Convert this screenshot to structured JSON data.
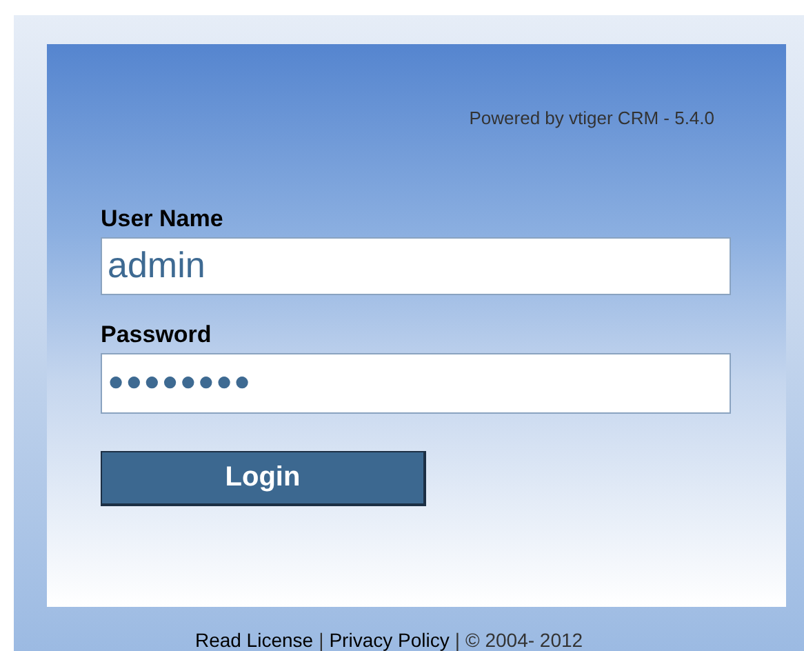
{
  "powered_by": "Powered by vtiger CRM - 5.4.0",
  "fields": [
    {
      "label": "User Name",
      "value": "admin"
    },
    {
      "label": "Password",
      "value": "●●●●●●●●"
    }
  ],
  "login_button": "Login",
  "footer": [
    {
      "kind": "link",
      "text": "Read License"
    },
    {
      "kind": "text",
      "text": "|"
    },
    {
      "kind": "link",
      "text": "Privacy Policy"
    },
    {
      "kind": "text",
      "text": "|"
    },
    {
      "kind": "text",
      "text": "© 2004- 2012"
    }
  ]
}
